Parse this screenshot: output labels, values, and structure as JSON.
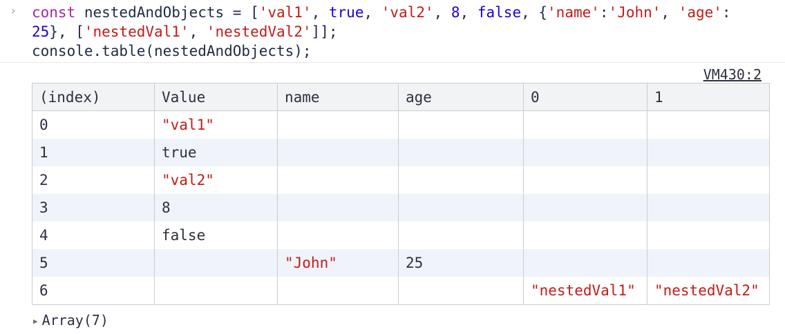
{
  "prompt_symbol": "›",
  "code": {
    "line1_prefix": "const nestedAndObjects = [",
    "line2": "25}, ['nestedVal1', 'nestedVal2']];",
    "line3": "console.table(nestedAndObjects);"
  },
  "source_link": "VM430:2",
  "table": {
    "headers": [
      "(index)",
      "Value",
      "name",
      "age",
      "0",
      "1"
    ],
    "rows": [
      {
        "index": "0",
        "value": "\"val1\"",
        "name": "",
        "age": "",
        "c0": "",
        "c1": ""
      },
      {
        "index": "1",
        "value": "true",
        "name": "",
        "age": "",
        "c0": "",
        "c1": ""
      },
      {
        "index": "2",
        "value": "\"val2\"",
        "name": "",
        "age": "",
        "c0": "",
        "c1": ""
      },
      {
        "index": "3",
        "value": "8",
        "name": "",
        "age": "",
        "c0": "",
        "c1": ""
      },
      {
        "index": "4",
        "value": "false",
        "name": "",
        "age": "",
        "c0": "",
        "c1": ""
      },
      {
        "index": "5",
        "value": "",
        "name": "\"John\"",
        "age": "25",
        "c0": "",
        "c1": ""
      },
      {
        "index": "6",
        "value": "",
        "name": "",
        "age": "",
        "c0": "\"nestedVal1\"",
        "c1": "\"nestedVal2\""
      }
    ]
  },
  "footer": {
    "expand_icon": "triangle-right-icon",
    "label": "Array(7)"
  },
  "colors": {
    "string": "#c41a16",
    "header_bg": "#f1f3f4",
    "alt_row_bg": "#f0f4fa",
    "border": "#c9ccd1"
  }
}
